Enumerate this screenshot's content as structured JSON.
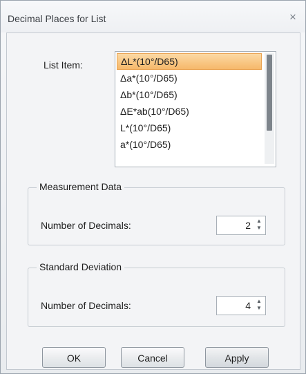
{
  "window": {
    "title": "Decimal Places for List",
    "close_glyph": "×"
  },
  "list": {
    "label": "List Item:",
    "selected_index": 0,
    "items": [
      "ΔL*(10°/D65)",
      "Δa*(10°/D65)",
      "Δb*(10°/D65)",
      "ΔE*ab(10°/D65)",
      "L*(10°/D65)",
      "a*(10°/D65)"
    ]
  },
  "measurement_data": {
    "legend": "Measurement Data",
    "label": "Number of Decimals:",
    "value": "2"
  },
  "standard_deviation": {
    "legend": "Standard Deviation",
    "label": "Number of Decimals:",
    "value": "4"
  },
  "buttons": {
    "ok": "OK",
    "cancel": "Cancel",
    "apply": "Apply"
  },
  "colors": {
    "selection": "#f6b86a",
    "accent_border": "#e9a24f"
  },
  "icons": {
    "close": "close-icon",
    "spin_up": "chevron-up-icon",
    "spin_down": "chevron-down-icon"
  }
}
